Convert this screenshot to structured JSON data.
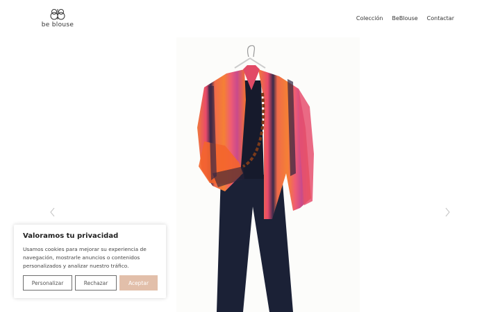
{
  "header": {
    "logo_text": "be blouse",
    "logo_icon": "bb-monogram-icon",
    "nav": [
      {
        "label": "Colección"
      },
      {
        "label": "BeBlouse"
      },
      {
        "label": "Contactar"
      }
    ]
  },
  "hero": {
    "icons": {
      "prev": "chevron-left-icon",
      "next": "chevron-right-icon"
    },
    "colors": {
      "blouse_pink": "#ef5a6e",
      "blouse_orange": "#f2762f",
      "pants_navy": "#1b2136",
      "necklace_brown": "#7a3a1a"
    }
  },
  "cookie_banner": {
    "title": "Valoramos tu privacidad",
    "text": "Usamos cookies para mejorar su experiencia de navegación, mostrarle anuncios o contenidos personalizados y analizar nuestro tráfico.",
    "buttons": {
      "customize": "Personalizar",
      "reject": "Rechazar",
      "accept": "Aceptar"
    },
    "accent_color": "#e2bfaa"
  }
}
